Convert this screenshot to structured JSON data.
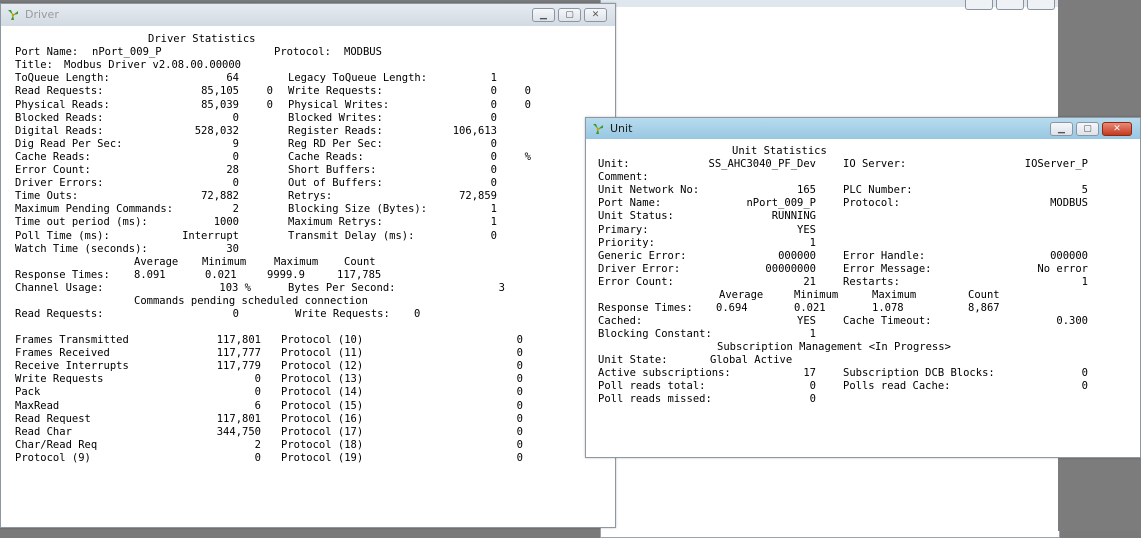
{
  "driver_window": {
    "title": "Driver",
    "heading": "Driver Statistics",
    "port_label": "Port Name:",
    "port_value": "nPort_009_P",
    "protocol_label": "Protocol:",
    "protocol_value": "MODBUS",
    "title_label": "Title:",
    "title_value": "Modbus Driver v2.08.00.00000",
    "rows": [
      {
        "l1": "ToQueue Length:",
        "v1": "64",
        "l2": "Legacy ToQueue Length:",
        "v2": "1"
      },
      {
        "l1": "Read Requests:",
        "v1": "85,105",
        "x1": "0",
        "l2": "Write Requests:",
        "v2": "0",
        "x2": "0"
      },
      {
        "l1": "Physical Reads:",
        "v1": "85,039",
        "x1": "0",
        "l2": "Physical Writes:",
        "v2": "0",
        "x2": "0"
      },
      {
        "l1": "Blocked Reads:",
        "v1": "0",
        "l2": "Blocked Writes:",
        "v2": "0"
      },
      {
        "l1": "Digital Reads:",
        "v1": "528,032",
        "l2": "Register Reads:",
        "v2": "106,613"
      },
      {
        "l1": "Dig Read Per Sec:",
        "v1": "9",
        "l2": "Reg RD Per Sec:",
        "v2": "0"
      },
      {
        "l1": "Cache Reads:",
        "v1": "0",
        "l2": "Cache Reads:",
        "v2": "0",
        "x2": "%"
      },
      {
        "l1": "Error Count:",
        "v1": "28",
        "l2": "Short Buffers:",
        "v2": "0"
      },
      {
        "l1": "Driver Errors:",
        "v1": "0",
        "l2": "Out of Buffers:",
        "v2": "0"
      },
      {
        "l1": "Time Outs:",
        "v1": "72,882",
        "l2": "Retrys:",
        "v2": "72,859"
      },
      {
        "l1": "Maximum Pending Commands:",
        "v1": "2",
        "l2": "Blocking Size (Bytes):",
        "v2": "1"
      },
      {
        "l1": "Time out period (ms):",
        "v1": "1000",
        "l2": "Maximum Retrys:",
        "v2": "1"
      },
      {
        "l1": "Poll Time (ms):",
        "v1": "Interrupt",
        "l2": "Transmit Delay (ms):",
        "v2": "0"
      },
      {
        "l1": "Watch Time (seconds):",
        "v1": "30",
        "l2": "",
        "v2": ""
      }
    ],
    "resp_headers": {
      "average": "Average",
      "minimum": "Minimum",
      "maximum": "Maximum",
      "count": "Count"
    },
    "resp_label": "Response Times:",
    "resp_values": {
      "average": "8.091",
      "minimum": "0.021",
      "maximum": "9999.9",
      "count": "117,785"
    },
    "channel_usage_label": "Channel Usage:",
    "channel_usage_value": "103 %",
    "bytes_per_sec_label": "Bytes Per Second:",
    "bytes_per_sec_value": "3",
    "pending_heading": "Commands pending scheduled connection",
    "pending_read_label": "Read Requests:",
    "pending_read_value": "0",
    "pending_write_label": "Write Requests:",
    "pending_write_value": "0",
    "frames": [
      {
        "l1": "Frames Transmitted",
        "v1": "117,801",
        "l2": "Protocol (10)",
        "v2": "0"
      },
      {
        "l1": "Frames Received",
        "v1": "117,777",
        "l2": "Protocol (11)",
        "v2": "0"
      },
      {
        "l1": "Receive Interrupts",
        "v1": "117,779",
        "l2": "Protocol (12)",
        "v2": "0"
      },
      {
        "l1": "Write Requests",
        "v1": "0",
        "l2": "Protocol (13)",
        "v2": "0"
      },
      {
        "l1": "Pack",
        "v1": "0",
        "l2": "Protocol (14)",
        "v2": "0"
      },
      {
        "l1": "MaxRead",
        "v1": "6",
        "l2": "Protocol (15)",
        "v2": "0"
      },
      {
        "l1": "Read Request",
        "v1": "117,801",
        "l2": "Protocol (16)",
        "v2": "0"
      },
      {
        "l1": "Read Char",
        "v1": "344,750",
        "l2": "Protocol (17)",
        "v2": "0"
      },
      {
        "l1": "Char/Read Req",
        "v1": "2",
        "l2": "Protocol (18)",
        "v2": "0"
      },
      {
        "l1": "Protocol (9)",
        "v1": "0",
        "l2": "Protocol (19)",
        "v2": "0"
      }
    ]
  },
  "unit_window": {
    "title": "Unit",
    "heading": "Unit Statistics",
    "rows1": [
      {
        "l1": "Unit:",
        "v1": "SS_AHC3040_PF_Dev",
        "l2": "IO Server:",
        "v2": "IOServer_P"
      },
      {
        "l1": "Comment:",
        "v1": "",
        "l2": "",
        "v2": ""
      },
      {
        "l1": "Unit Network No:",
        "v1": "165",
        "l2": "PLC Number:",
        "v2": "5"
      },
      {
        "l1": "Port Name:",
        "v1": "nPort_009_P",
        "l2": "Protocol:",
        "v2": "MODBUS"
      },
      {
        "l1": "Unit Status:",
        "v1": "RUNNING",
        "l2": "",
        "v2": ""
      },
      {
        "l1": "Primary:",
        "v1": "YES",
        "l2": "",
        "v2": ""
      },
      {
        "l1": "Priority:",
        "v1": "1",
        "l2": "",
        "v2": ""
      },
      {
        "l1": "Generic Error:",
        "v1": "000000",
        "l2": "Error Handle:",
        "v2": "000000"
      },
      {
        "l1": "Driver Error:",
        "v1": "00000000",
        "l2": "Error Message:",
        "v2": "No error"
      },
      {
        "l1": "Error Count:",
        "v1": "21",
        "l2": "Restarts:",
        "v2": "1"
      }
    ],
    "resp_headers": {
      "average": "Average",
      "minimum": "Minimum",
      "maximum": "Maximum",
      "count": "Count"
    },
    "resp_label": "Response Times:",
    "resp_values": {
      "average": "0.694",
      "minimum": "0.021",
      "maximum": "1.078",
      "count": "8,867"
    },
    "cached_label": "Cached:",
    "cached_value": "YES",
    "cache_timeout_label": "Cache Timeout:",
    "cache_timeout_value": "0.300",
    "blocking_label": "Blocking Constant:",
    "blocking_value": "1",
    "sub_heading": "Subscription Management <In Progress>",
    "unit_state_label": "Unit State:",
    "unit_state_value": "Global Active",
    "rows2": [
      {
        "l1": "Active subscriptions:",
        "v1": "17",
        "l2": "Subscription DCB Blocks:",
        "v2": "0"
      },
      {
        "l1": "Poll reads total:",
        "v1": "0",
        "l2": "Polls read Cache:",
        "v2": "0"
      },
      {
        "l1": "Poll reads missed:",
        "v1": "0",
        "l2": "",
        "v2": ""
      }
    ]
  },
  "icons": {
    "app": "windmill-icon",
    "minimize": "minimize-icon",
    "maximize": "maximize-icon",
    "close": "close-icon"
  },
  "colors": {
    "unit_titlebar": "#96c6e1",
    "driver_titlebar": "#d2dae3",
    "close_red": "#c4391f"
  }
}
